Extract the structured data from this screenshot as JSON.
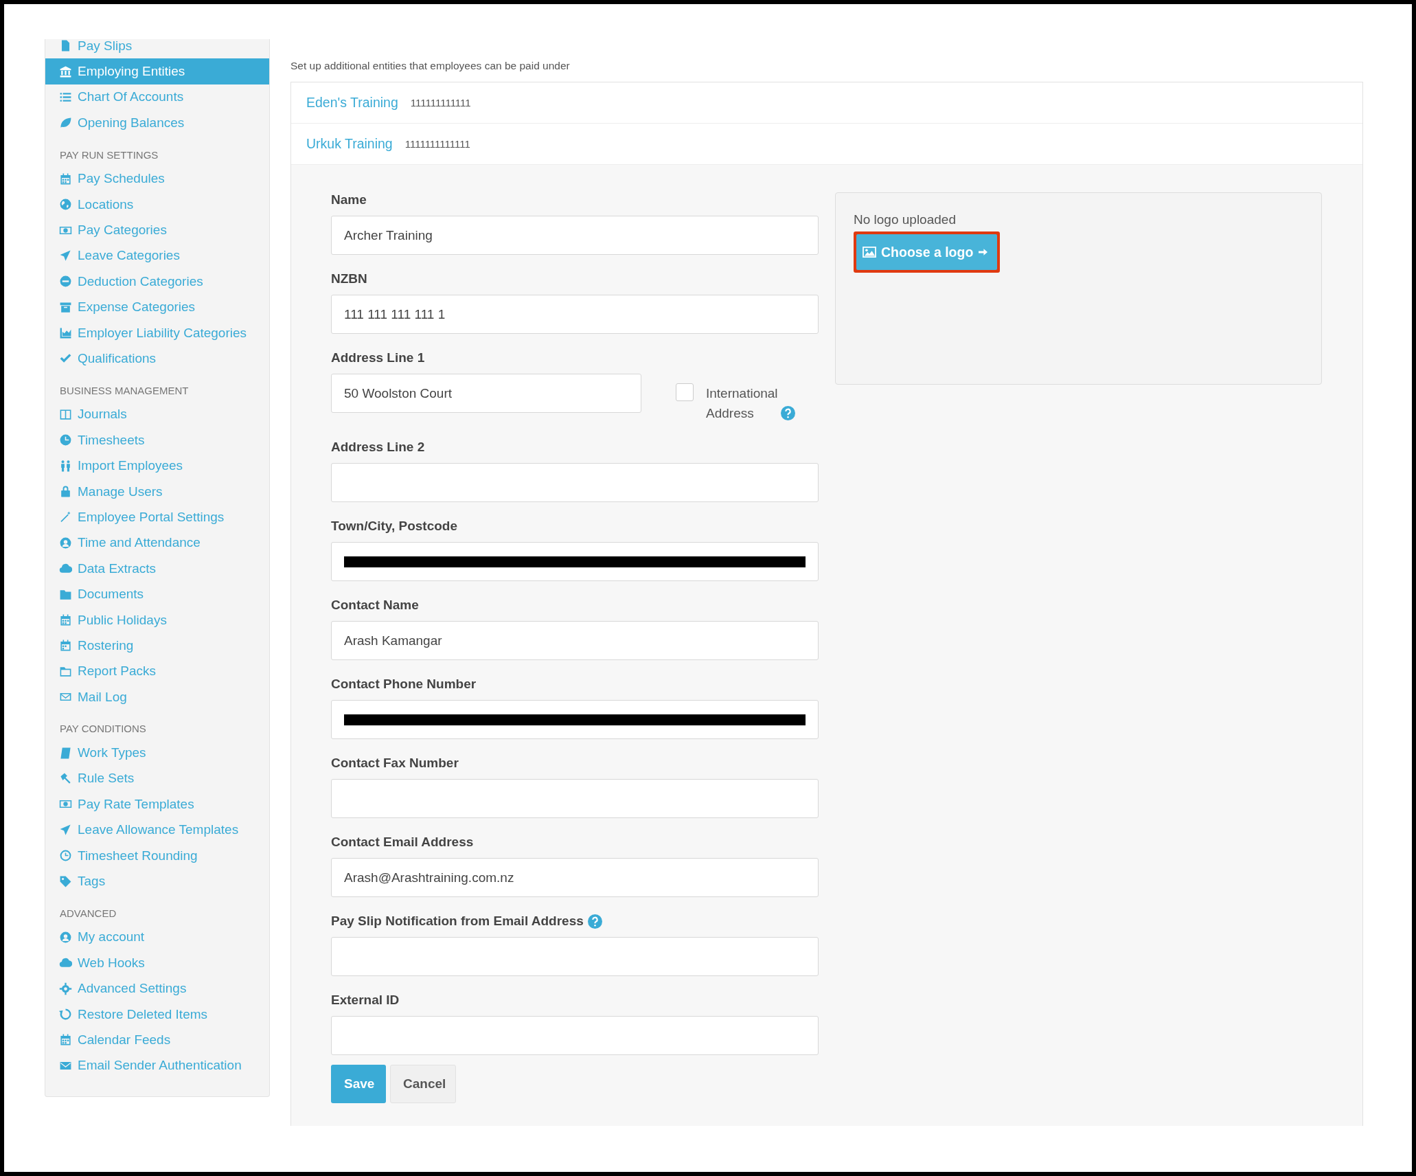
{
  "sidebar": {
    "sections": [
      {
        "items": [
          {
            "label": "Pay Slips",
            "selected": false
          },
          {
            "label": "Employing Entities",
            "selected": true
          },
          {
            "label": "Chart Of Accounts",
            "selected": false
          },
          {
            "label": "Opening Balances",
            "selected": false
          }
        ]
      },
      {
        "heading": "PAY RUN SETTINGS",
        "items": [
          {
            "label": "Pay Schedules",
            "selected": false
          },
          {
            "label": "Locations",
            "selected": false
          },
          {
            "label": "Pay Categories",
            "selected": false
          },
          {
            "label": "Leave Categories",
            "selected": false
          },
          {
            "label": "Deduction Categories",
            "selected": false
          },
          {
            "label": "Expense Categories",
            "selected": false
          },
          {
            "label": "Employer Liability Categories",
            "selected": false
          },
          {
            "label": "Qualifications",
            "selected": false
          }
        ]
      },
      {
        "heading": "BUSINESS MANAGEMENT",
        "items": [
          {
            "label": "Journals",
            "selected": false
          },
          {
            "label": "Timesheets",
            "selected": false
          },
          {
            "label": "Import Employees",
            "selected": false
          },
          {
            "label": "Manage Users",
            "selected": false
          },
          {
            "label": "Employee Portal Settings",
            "selected": false
          },
          {
            "label": "Time and Attendance",
            "selected": false
          },
          {
            "label": "Data Extracts",
            "selected": false
          },
          {
            "label": "Documents",
            "selected": false
          },
          {
            "label": "Public Holidays",
            "selected": false
          },
          {
            "label": "Rostering",
            "selected": false
          },
          {
            "label": "Report Packs",
            "selected": false
          },
          {
            "label": "Mail Log",
            "selected": false
          }
        ]
      },
      {
        "heading": "PAY CONDITIONS",
        "items": [
          {
            "label": "Work Types",
            "selected": false
          },
          {
            "label": "Rule Sets",
            "selected": false
          },
          {
            "label": "Pay Rate Templates",
            "selected": false
          },
          {
            "label": "Leave Allowance Templates",
            "selected": false
          },
          {
            "label": "Timesheet Rounding",
            "selected": false
          },
          {
            "label": "Tags",
            "selected": false
          }
        ]
      },
      {
        "heading": "ADVANCED",
        "items": [
          {
            "label": "My account",
            "selected": false
          },
          {
            "label": "Web Hooks",
            "selected": false
          },
          {
            "label": "Advanced Settings",
            "selected": false
          },
          {
            "label": "Restore Deleted Items",
            "selected": false
          },
          {
            "label": "Calendar Feeds",
            "selected": false
          },
          {
            "label": "Email Sender Authentication",
            "selected": false
          }
        ]
      }
    ]
  },
  "description": "Set up additional entities that employees can be paid under",
  "entities": [
    {
      "name": "Eden's Training",
      "number": "111111111111"
    },
    {
      "name": "Urkuk Training",
      "number": "1111111111111"
    }
  ],
  "form": {
    "fields": [
      {
        "label": "Name",
        "value": "Archer Training"
      },
      {
        "label": "NZBN",
        "value": "111 111 111 111 1"
      },
      {
        "label": "Address Line 1",
        "value": "50 Woolston Court",
        "checkbox": {
          "label": "International Address",
          "checked": false,
          "help": true
        }
      },
      {
        "label": "Address Line 2"
      },
      {
        "label": "Town/City, Postcode",
        "redacted": true
      },
      {
        "label": "Contact Name",
        "value": "Arash Kamangar"
      },
      {
        "label": "Contact Phone Number",
        "redacted": true
      },
      {
        "label": "Contact Fax Number"
      },
      {
        "label": "Contact Email Address",
        "value": "Arash@Arashtraining.com.nz"
      },
      {
        "label": "Pay Slip Notification from Email Address",
        "help": true
      },
      {
        "label": "External ID"
      }
    ],
    "buttons": [
      {
        "label": "Save",
        "kind": "primary"
      },
      {
        "label": "Cancel",
        "kind": "secondary"
      }
    ]
  },
  "logo": {
    "status": "No logo uploaded",
    "button": "Choose a logo",
    "highlighted": true
  }
}
